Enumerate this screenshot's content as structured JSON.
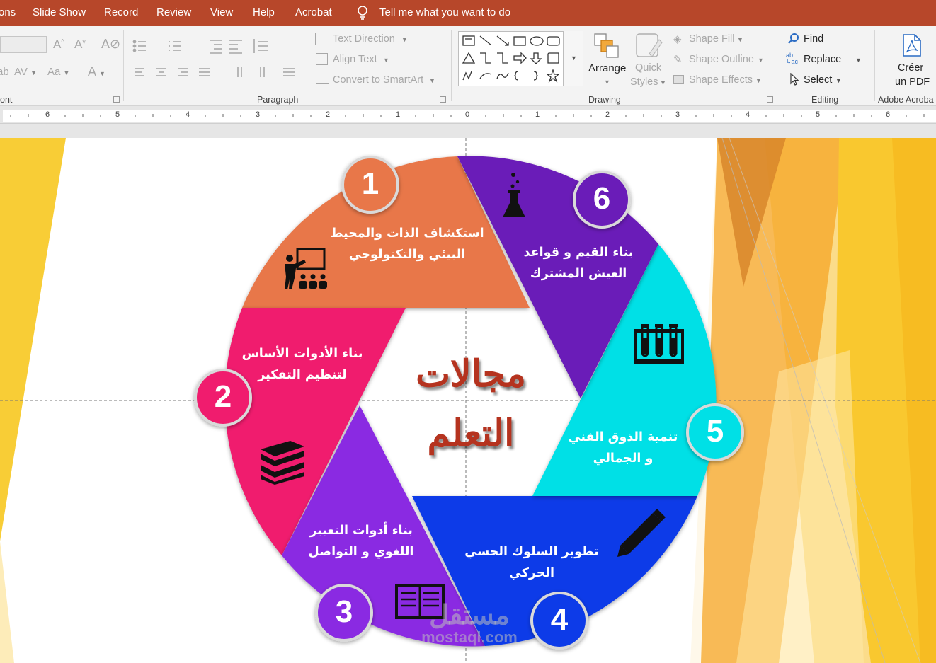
{
  "menu": [
    "ons",
    "Slide Show",
    "Record",
    "Review",
    "View",
    "Help",
    "Acrobat"
  ],
  "tell_me": "Tell me what you want to do",
  "ribbon": {
    "font_group": "ont",
    "paragraph_group": "Paragraph",
    "text_direction": "Text Direction",
    "align_text": "Align Text",
    "convert_smartart": "Convert to SmartArt",
    "drawing_group": "Drawing",
    "arrange": "Arrange",
    "quick_styles_1": "Quick",
    "quick_styles_2": "Styles",
    "shape_fill": "Shape Fill",
    "shape_outline": "Shape Outline",
    "shape_effects": "Shape Effects",
    "editing_group": "Editing",
    "find": "Find",
    "replace": "Replace",
    "select": "Select",
    "create_pdf_1": "Créer",
    "create_pdf_2": "un PDF",
    "acrobat_group": "Adobe Acroba"
  },
  "ruler_numbers": [
    "6",
    "5",
    "4",
    "3",
    "2",
    "1",
    "0",
    "1",
    "2",
    "3",
    "4",
    "5",
    "6"
  ],
  "slide": {
    "center_title_1": "مجالات",
    "center_title_2": "التعلم",
    "segments": [
      {
        "number": "1",
        "line1": "استكشاف الذات والمحيط",
        "line2": "البيئي والتكنولوجي",
        "color": "#e8774a",
        "icon": "teacher-board-icon"
      },
      {
        "number": "2",
        "line1": "بناء الأدوات الأساس",
        "line2": "لتنظيم التفكير",
        "color": "#f01c6e",
        "icon": "books-stack-icon"
      },
      {
        "number": "3",
        "line1": "بناء أدوات التعبير",
        "line2": "اللغوي و التواصل",
        "color": "#8a2be2",
        "icon": "open-book-icon"
      },
      {
        "number": "4",
        "line1": "تطوير السلوك الحسي",
        "line2": "الحركي",
        "color": "#0d3be8",
        "icon": "pencil-icon"
      },
      {
        "number": "5",
        "line1": "تنمية الذوق الفني",
        "line2": "و الجمالي",
        "color": "#05e0e6",
        "icon": "test-tubes-icon"
      },
      {
        "number": "6",
        "line1": "بناء القيم و قواعد",
        "line2": "العيش المشترك",
        "color": "#6b1bb8",
        "icon": "flask-icon"
      }
    ],
    "watermark_ar": "مستقل",
    "watermark_en": "mostaql.com"
  }
}
